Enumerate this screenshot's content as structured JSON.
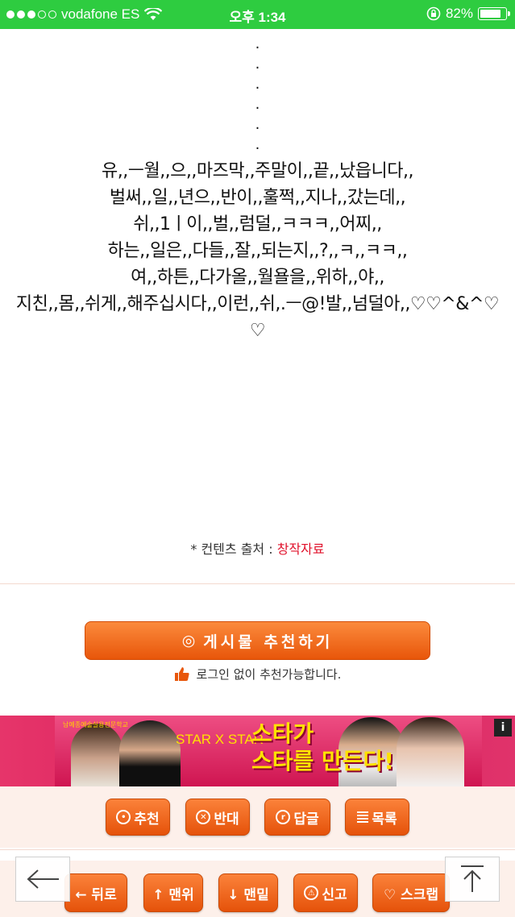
{
  "statusbar": {
    "carrier": "vodafone ES",
    "time": "오후 1:34",
    "battery": "82%",
    "battery_level": 0.82
  },
  "article": {
    "dots": [
      ".",
      ".",
      ".",
      ".",
      ".",
      "."
    ],
    "lines": [
      "유,,ㅡ월,,으,,마즈막,,주말이,,끝,,났읍니다,,",
      "벌써,,일,,년으,,반이,,훌쩍,,지나,,갔는데,,",
      "쉬,,1ㅣ이,,벌,,럼덜,,ㅋㅋㅋ,,어찌,,",
      "하는,,일은,,다들,,잘,,되는지,,?,,ㅋ,,ㅋㅋ,,",
      "여,,하튼,,다가올,,월욜을,,위하,,야,,",
      "지친,,몸,,쉬게,,해주십시다,,이런,,쉬,.ㅡ@!발,,넘덜아,,♡♡^&^♡",
      "♡"
    ]
  },
  "source": {
    "label": "* 컨텐츠 출처 : ",
    "link": "창작자료"
  },
  "recommend": {
    "icon": "◎",
    "label": "게시물  추천하기",
    "note": "로그인 없이 추천가능합니다."
  },
  "banner": {
    "logo": "남예종예술실용전문학교",
    "star_text": "STAR X STAR",
    "headline_1": "스타가",
    "headline_2": "스타를 만든다!",
    "info": "i"
  },
  "actions": {
    "recommend": "추천",
    "oppose": "반대",
    "reply": "답글",
    "list": "목록"
  },
  "bottom": {
    "back": "← 뒤로",
    "top": "↑ 맨위",
    "bottom": "↓ 맨밑",
    "report": "신고",
    "scrap": "♡ 스크랩"
  },
  "colors": {
    "status_green": "#2ecc40",
    "accent_orange": "#ef6a1c",
    "link_red": "#e0102a"
  }
}
